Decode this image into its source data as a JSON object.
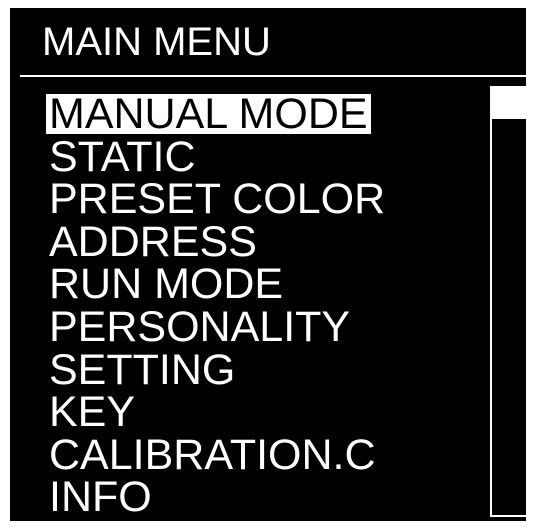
{
  "header": {
    "title": "MAIN MENU"
  },
  "menu": {
    "selected_index": 0,
    "items": [
      {
        "label": "MANUAL MODE"
      },
      {
        "label": "STATIC"
      },
      {
        "label": "PRESET COLOR"
      },
      {
        "label": "ADDRESS"
      },
      {
        "label": "RUN MODE"
      },
      {
        "label": "PERSONALITY"
      },
      {
        "label": "SETTING"
      },
      {
        "label": "KEY"
      },
      {
        "label": "CALIBRATION.C"
      },
      {
        "label": "INFO"
      }
    ]
  },
  "scrollbar": {
    "position_fraction": 0.0
  },
  "colors": {
    "background": "#000000",
    "foreground": "#ffffff"
  }
}
